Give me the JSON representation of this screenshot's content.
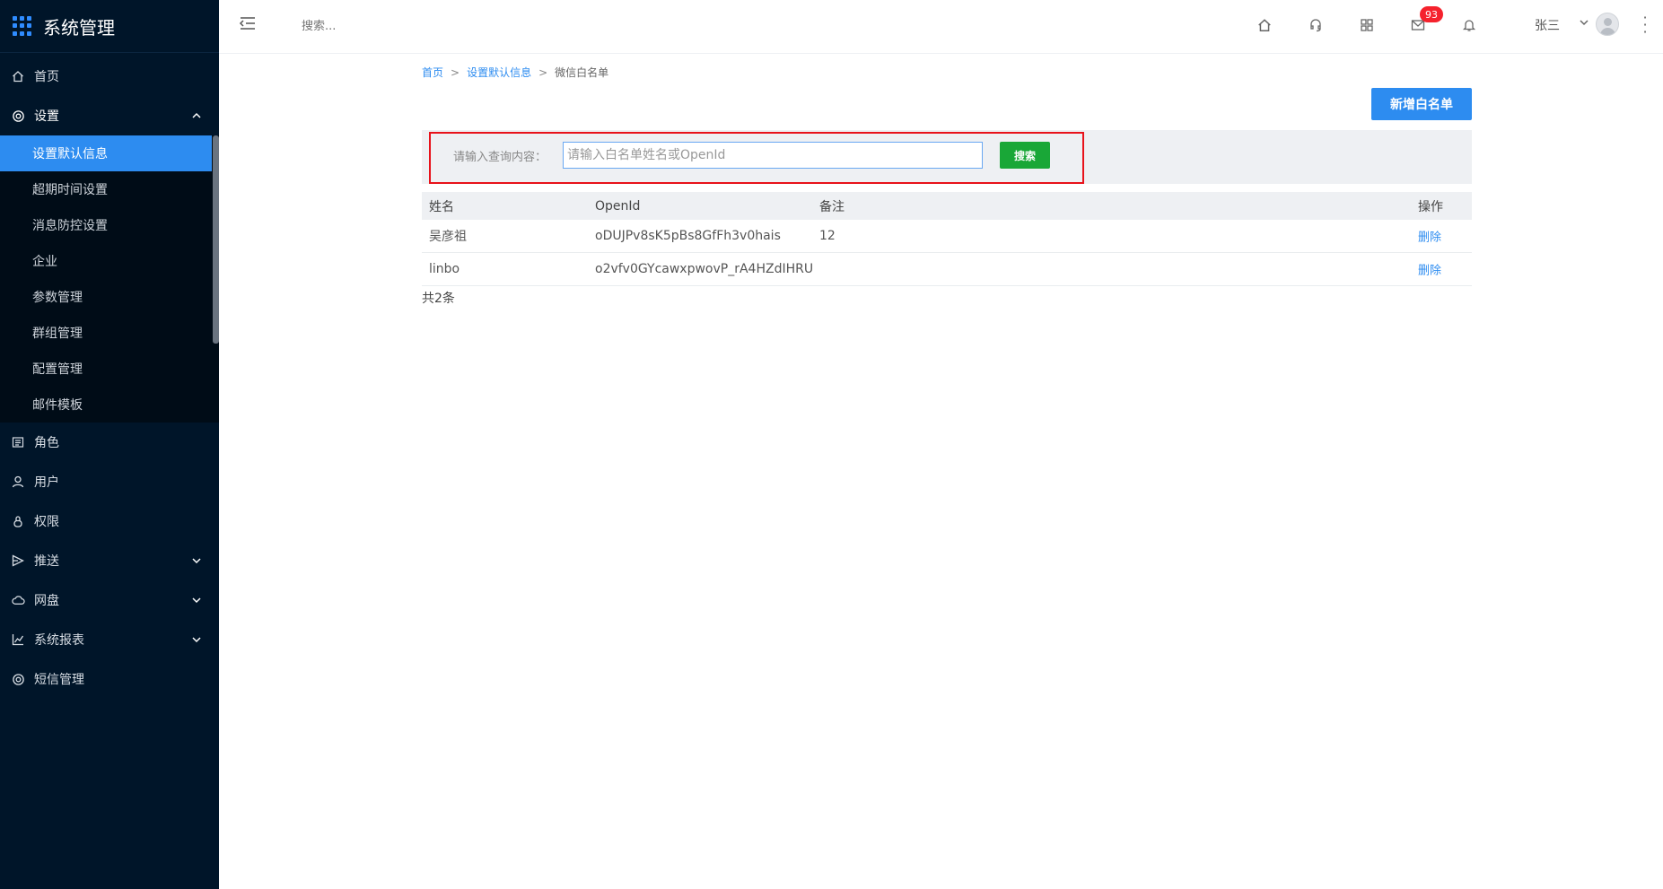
{
  "app": {
    "title": "系统管理"
  },
  "sidebar": {
    "items_top": [
      {
        "label": "首页",
        "icon": "home-icon"
      },
      {
        "label": "设置",
        "icon": "gear-icon",
        "expanded": true
      }
    ],
    "submenu": [
      {
        "label": "设置默认信息",
        "active": true
      },
      {
        "label": "超期时间设置"
      },
      {
        "label": "消息防控设置"
      },
      {
        "label": "企业"
      },
      {
        "label": "参数管理"
      },
      {
        "label": "群组管理"
      },
      {
        "label": "配置管理"
      },
      {
        "label": "邮件模板"
      }
    ],
    "items_bottom": [
      {
        "label": "角色",
        "icon": "role-icon"
      },
      {
        "label": "用户",
        "icon": "user-icon"
      },
      {
        "label": "权限",
        "icon": "lock-icon"
      },
      {
        "label": "推送",
        "icon": "send-icon"
      },
      {
        "label": "网盘",
        "icon": "cloud-icon"
      },
      {
        "label": "系统报表",
        "icon": "chart-icon"
      },
      {
        "label": "短信管理",
        "icon": "gear-icon"
      }
    ]
  },
  "header": {
    "search_placeholder": "搜索...",
    "mail_badge": "93",
    "username": "张三"
  },
  "breadcrumb": {
    "home": "首页",
    "parent": "设置默认信息",
    "current": "微信白名单",
    "separator": ">"
  },
  "toolbar": {
    "add_label": "新增白名单"
  },
  "query": {
    "label": "请输入查询内容：",
    "placeholder": "请输入白名单姓名或OpenId",
    "search_label": "搜索"
  },
  "table": {
    "columns": [
      "姓名",
      "OpenId",
      "备注",
      "操作"
    ],
    "rows": [
      {
        "name": "吴彦祖",
        "openid": "oDUJPv8sK5pBs8GfFh3v0hais",
        "remark": "12",
        "action": "删除"
      },
      {
        "name": "linbo",
        "openid": "o2vfv0GYcawxpwovP_rA4HZdIHRU",
        "remark": "",
        "action": "删除"
      }
    ]
  },
  "pagination": {
    "total": "共2条"
  },
  "colors": {
    "sidebar_bg": "#001529",
    "primary": "#2d8cf0",
    "success": "#19a737",
    "highlight": "#e8121a",
    "badge": "#f5222d"
  }
}
